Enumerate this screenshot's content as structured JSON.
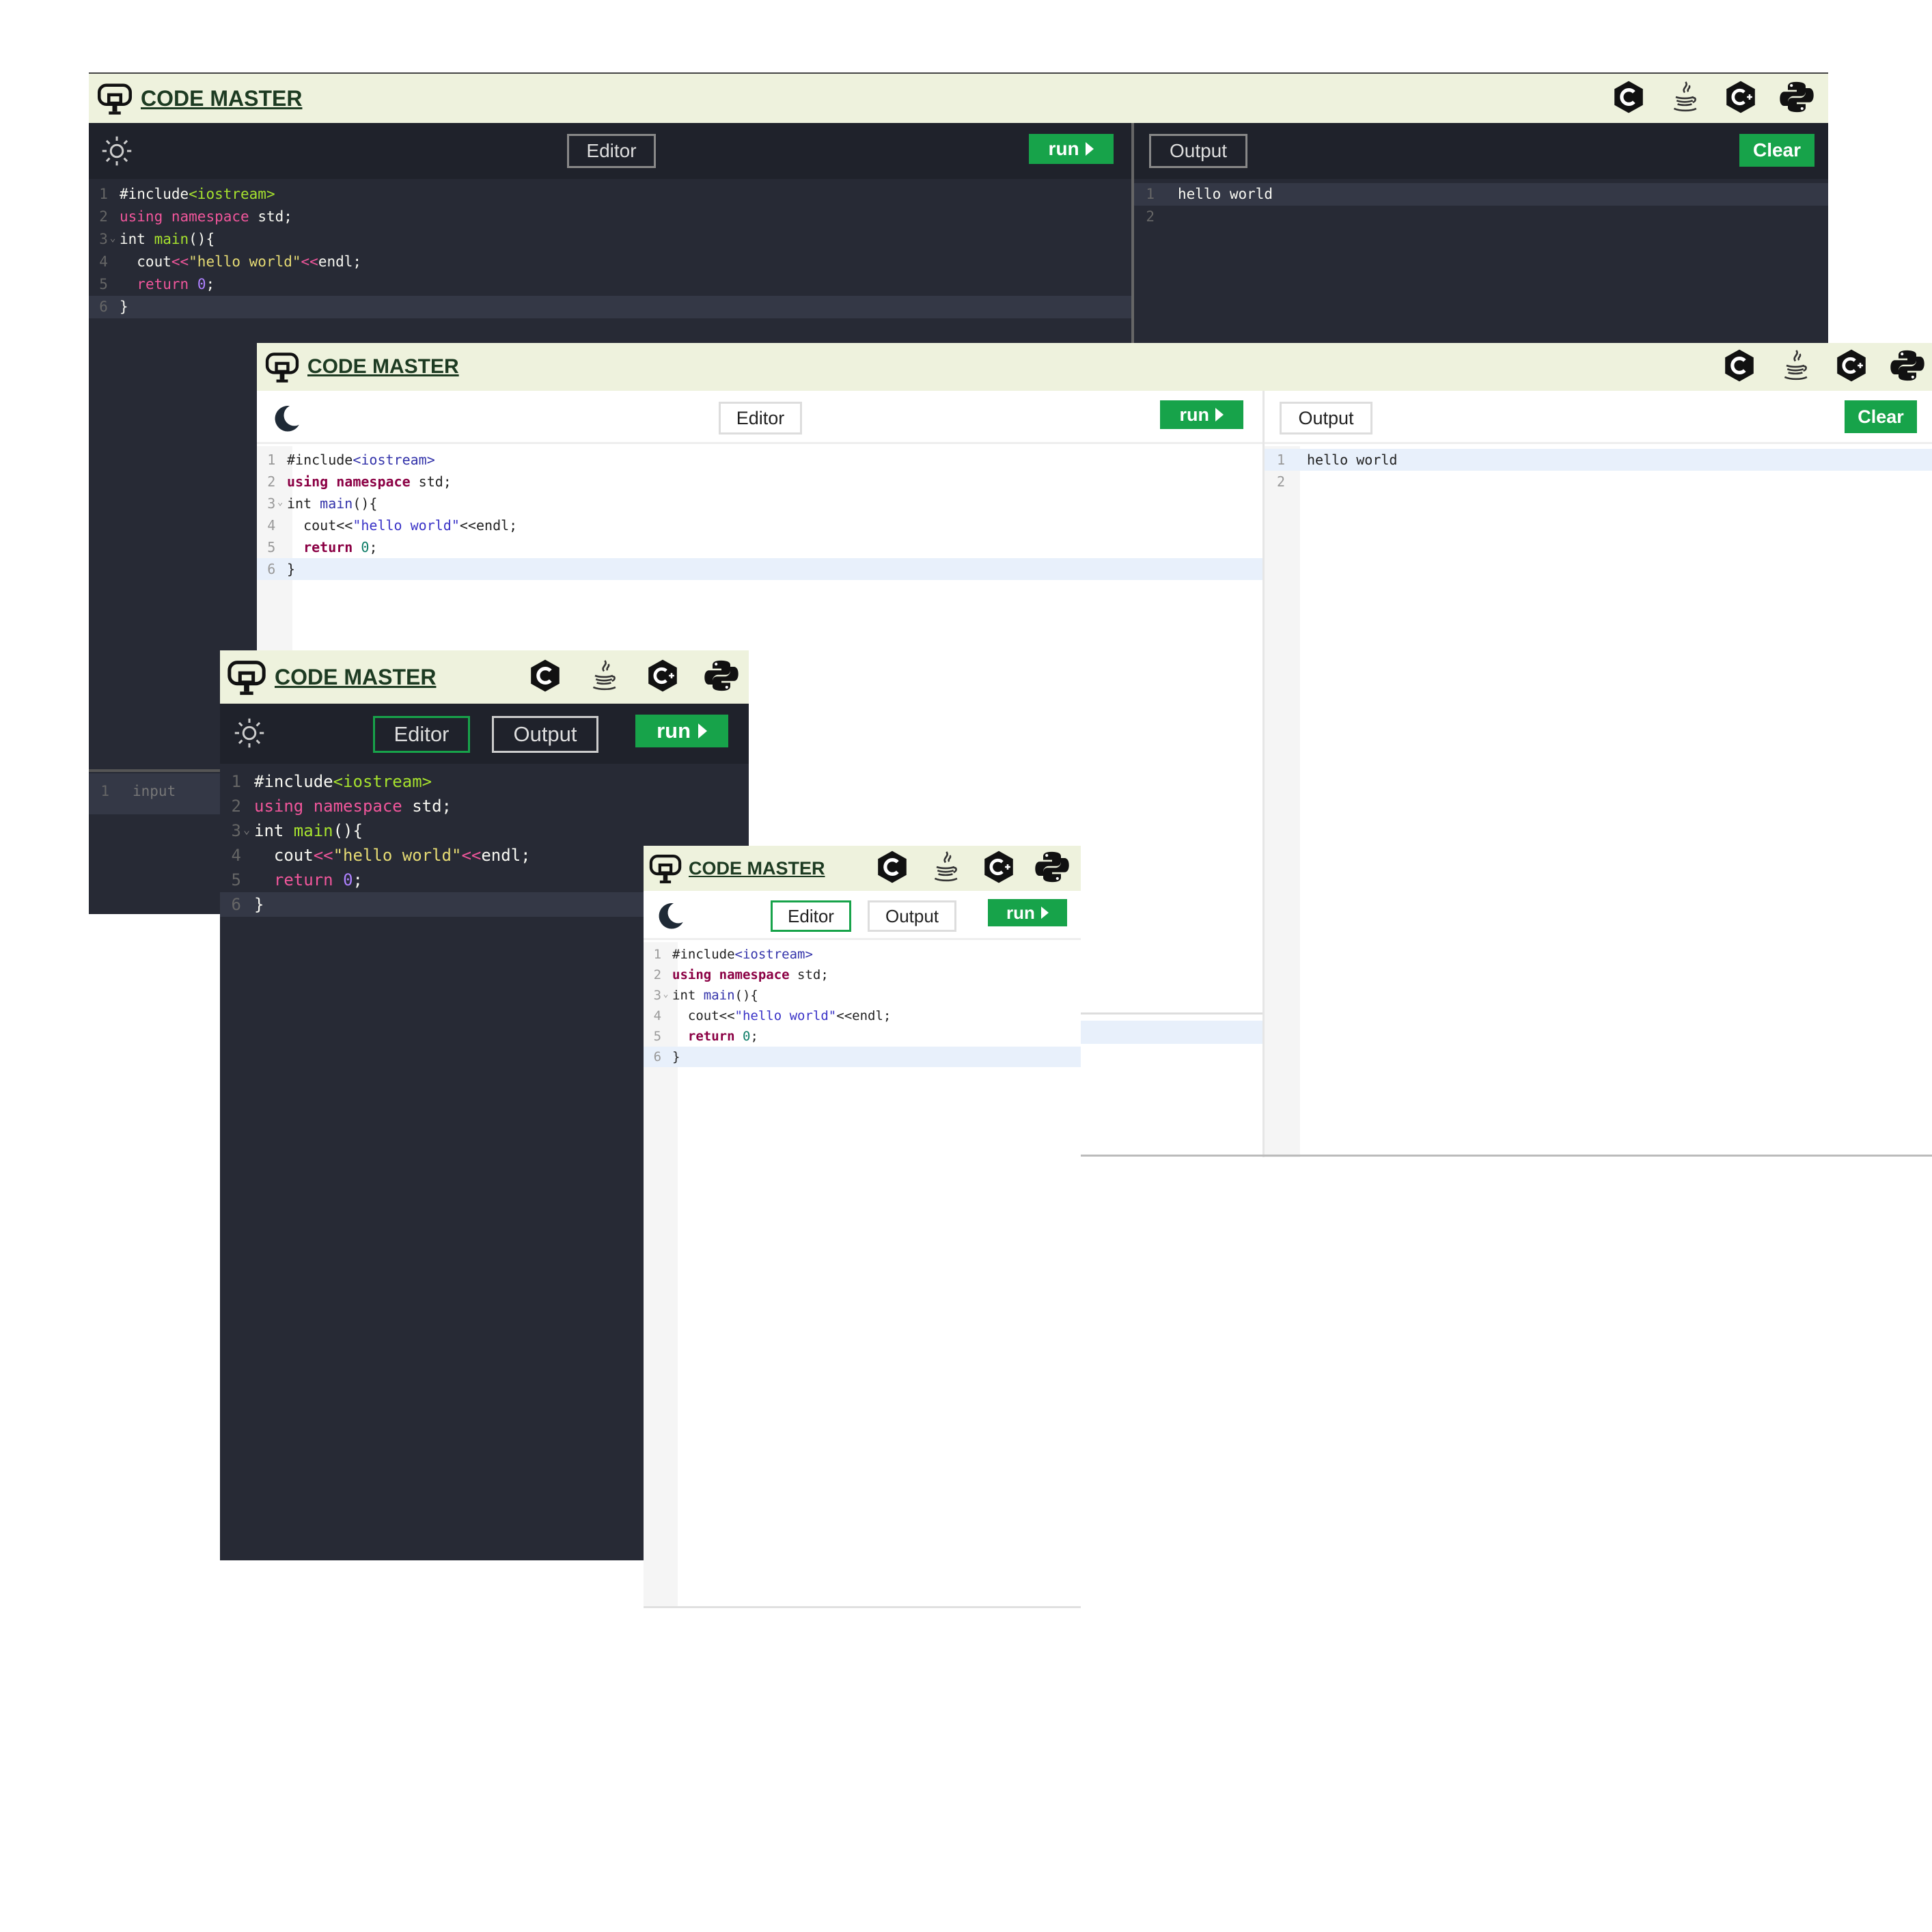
{
  "app": {
    "brand": "CODE MASTER"
  },
  "toolbar": {
    "editor_label": "Editor",
    "output_label": "Output",
    "run_label": "run",
    "clear_label": "Clear"
  },
  "languages": [
    "c-icon",
    "java-icon",
    "cpp-icon",
    "python-icon"
  ],
  "code": {
    "line_numbers": [
      "1",
      "2",
      "3",
      "4",
      "5",
      "6"
    ],
    "fold_marker": "⌄",
    "lines": [
      [
        {
          "t": "tx",
          "v": "#include"
        },
        {
          "t": "fn",
          "v": "<iostream>"
        }
      ],
      [
        {
          "t": "kw",
          "v": "using"
        },
        {
          "t": "tx",
          "v": " "
        },
        {
          "t": "kw",
          "v": "namespace"
        },
        {
          "t": "tx",
          "v": " std;"
        }
      ],
      [
        {
          "t": "tx",
          "v": "int "
        },
        {
          "t": "fn",
          "v": "main"
        },
        {
          "t": "tx",
          "v": "(){"
        }
      ],
      [
        {
          "t": "tx",
          "v": "  cout"
        },
        {
          "t": "op",
          "v": "<<"
        },
        {
          "t": "str",
          "v": "\"hello world\""
        },
        {
          "t": "op",
          "v": "<<"
        },
        {
          "t": "tx",
          "v": "endl;"
        }
      ],
      [
        {
          "t": "tx",
          "v": "  "
        },
        {
          "t": "kw",
          "v": "return"
        },
        {
          "t": "tx",
          "v": " "
        },
        {
          "t": "num",
          "v": "0"
        },
        {
          "t": "tx",
          "v": ";"
        }
      ],
      [
        {
          "t": "tx",
          "v": "}"
        }
      ]
    ]
  },
  "output": {
    "line_numbers": [
      "1",
      "2"
    ],
    "text": "hello world"
  },
  "input": {
    "line_number": "1",
    "placeholder": "input"
  },
  "colors": {
    "header_bg": "#eef2dd",
    "dark_bg": "#272a35",
    "dark_toolbar": "#1f222b",
    "run_green": "#17a34a",
    "light_active_line": "#e8f0fb"
  }
}
